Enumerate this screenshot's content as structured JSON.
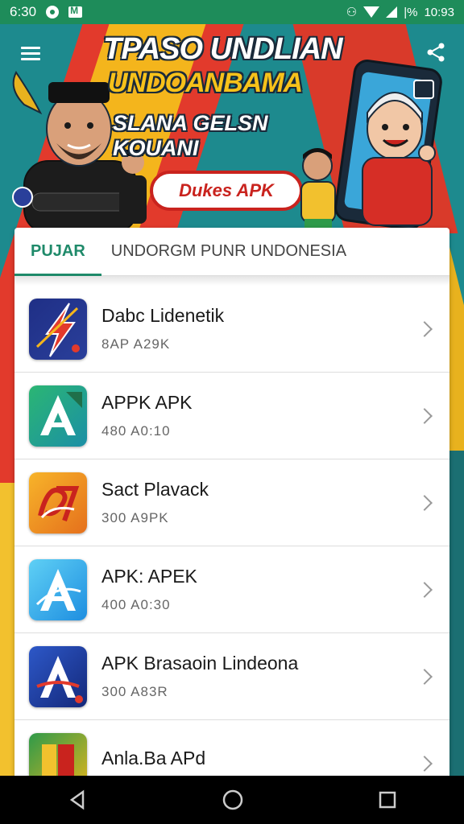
{
  "status_bar": {
    "time": "6:30",
    "battery_text": "|%",
    "clock_right": "10:93"
  },
  "banner": {
    "title_line1": "TPASO UNDLIAN",
    "title_line2": "UNDOANBAMA",
    "subtitle": "SLANA GELSN KOUANI",
    "button_label": "Dukes APK"
  },
  "tabs": {
    "active": "PUJAR",
    "inactive": "UNDORGM PUNR UNDONESIA"
  },
  "apps": [
    {
      "name": "Dabc Lidenetik",
      "meta": "8AP A29K",
      "icon": "lightning-app-icon",
      "colors": [
        "#2a3f9a",
        "#e23a2c"
      ]
    },
    {
      "name": "APPK APK",
      "meta": "480 A0:10",
      "icon": "a-letter-green-app-icon",
      "colors": [
        "#1f9e8a",
        "#2bb673"
      ]
    },
    {
      "name": "Sact Plavack",
      "meta": "300 A9PK",
      "icon": "play-logo-app-icon",
      "colors": [
        "#f49b1a",
        "#e5501c"
      ]
    },
    {
      "name": "APK: APEK",
      "meta": "400 A0:30",
      "icon": "a-letter-blue-app-icon",
      "colors": [
        "#1ea0e0",
        "#4fc3f7"
      ]
    },
    {
      "name": "APK Brasaoin Lindeona",
      "meta": "300 A83R",
      "icon": "a-letter-navy-app-icon",
      "colors": [
        "#1b3aa0",
        "#2d58c8"
      ]
    },
    {
      "name": "Anla.Ba APd",
      "meta": "",
      "icon": "book-app-icon",
      "colors": [
        "#e5b51c",
        "#2e9a4a"
      ]
    }
  ]
}
